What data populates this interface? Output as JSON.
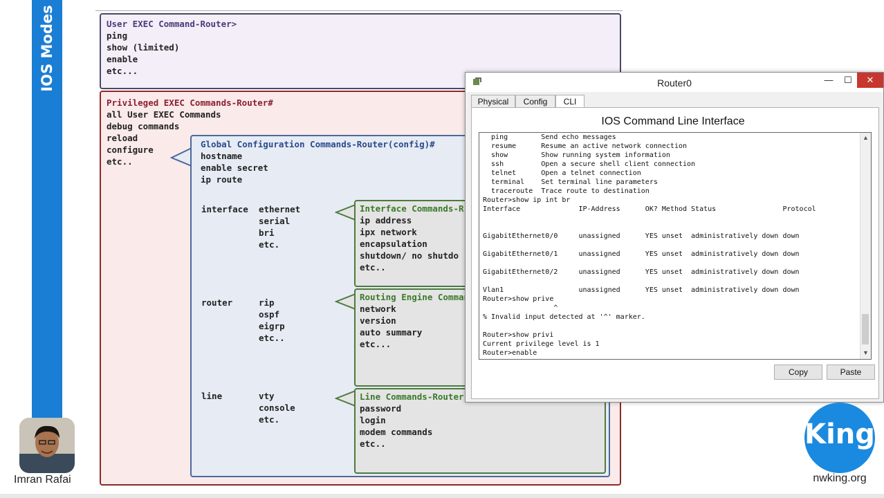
{
  "banner": {
    "title": "IOS Modes"
  },
  "presenter": {
    "name": "Imran Rafai"
  },
  "diagram": {
    "user_exec": {
      "title": "User EXEC Command-Router>",
      "lines": [
        "ping",
        "show (limited)",
        "enable",
        "etc..."
      ]
    },
    "privileged_exec": {
      "title": "Privileged EXEC Commands-Router#",
      "lines": [
        "all User EXEC Commands",
        "debug commands",
        "reload",
        "configure",
        "etc.."
      ]
    },
    "global_config": {
      "title": "Global Configuration Commands-Router(config)#",
      "lines": [
        "hostname",
        "enable secret",
        "ip route"
      ],
      "interface_label": "interface",
      "interface_items": [
        "ethernet",
        "serial",
        "bri",
        "etc."
      ],
      "router_label": "router",
      "router_items": [
        "rip",
        "ospf",
        "eigrp",
        "etc.."
      ],
      "line_label": "line",
      "line_items": [
        "vty",
        "console",
        "etc."
      ]
    },
    "interface_box": {
      "title": "Interface Commands-R",
      "lines": [
        "ip address",
        "ipx network",
        "encapsulation",
        "shutdown/ no shutdo",
        "etc.."
      ]
    },
    "routing_box": {
      "title": "Routing Engine Comman",
      "lines": [
        "network",
        "version",
        "auto summary",
        "etc..."
      ]
    },
    "line_box": {
      "title": "Line Commands-Router",
      "lines": [
        "password",
        "login",
        "modem commands",
        "etc.."
      ]
    }
  },
  "window": {
    "title": "Router0",
    "controls": {
      "minimize": "—",
      "maximize": "☐",
      "close": "✕"
    },
    "tabs": [
      {
        "label": "Physical",
        "active": false
      },
      {
        "label": "Config",
        "active": false
      },
      {
        "label": "CLI",
        "active": true
      }
    ],
    "heading": "IOS Command Line Interface",
    "terminal_lines": [
      "  ping        Send echo messages",
      "  resume      Resume an active network connection",
      "  show        Show running system information",
      "  ssh         Open a secure shell client connection",
      "  telnet      Open a telnet connection",
      "  terminal    Set terminal line parameters",
      "  traceroute  Trace route to destination",
      "Router>show ip int br",
      "Interface              IP-Address      OK? Method Status                Protocol",
      "",
      "",
      "GigabitEthernet0/0     unassigned      YES unset  administratively down down",
      "",
      "GigabitEthernet0/1     unassigned      YES unset  administratively down down",
      "",
      "GigabitEthernet0/2     unassigned      YES unset  administratively down down",
      "",
      "Vlan1                  unassigned      YES unset  administratively down down",
      "Router>show prive",
      "                 ^",
      "% Invalid input detected at '^' marker.",
      "",
      "Router>show privi",
      "Current privilege level is 1",
      "Router>enable"
    ],
    "buttons": {
      "copy": "Copy",
      "paste": "Paste"
    }
  },
  "logo": {
    "text": "King",
    "site": "nwking.org"
  },
  "colors": {
    "banner": "#1a7ed4",
    "logo": "#1a8ae0",
    "close_button": "#c7372f"
  }
}
